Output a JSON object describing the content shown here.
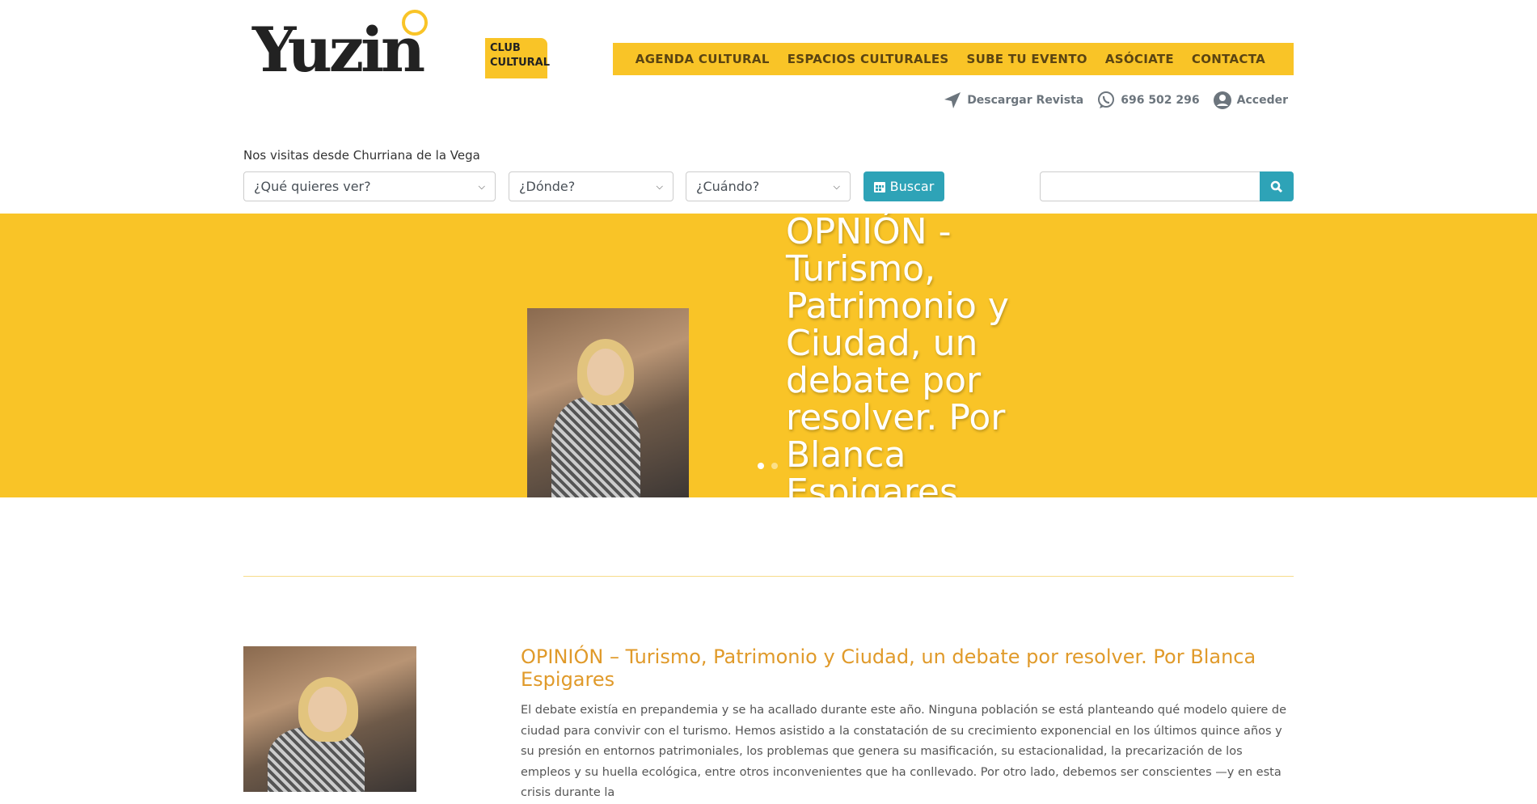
{
  "logo": {
    "word": "Yuzin",
    "tag": "CLUB CULTURAL"
  },
  "nav": [
    "AGENDA CULTURAL",
    "ESPACIOS CULTURALES",
    "SUBE TU EVENTO",
    "ASÓCIATE",
    "CONTACTA"
  ],
  "utility": {
    "magazine": "Descargar Revista",
    "phone": "696 502 296",
    "login": "Acceder"
  },
  "search": {
    "visit_text": "Nos visitas desde Churriana de la Vega",
    "what": "¿Qué quieres ver?",
    "where": "¿Dónde?",
    "when": "¿Cuándo?",
    "button": "Buscar",
    "query": ""
  },
  "colors": {
    "brand": "#f9c427",
    "accent": "#2ea3b7",
    "heading": "#e09a2a"
  },
  "slider": {
    "title": "OPNIÓN - Turismo, Patrimonio y Ciudad, un debate por resolver. Por Blanca Espigares"
  },
  "article": {
    "title": "OPINIÓN – Turismo, Patrimonio y Ciudad, un debate por resolver. Por Blanca Espigares",
    "body": "El debate existía en prepandemia y se ha acallado durante este año. Ninguna población se está planteando qué modelo quiere de ciudad para convivir con el turismo. Hemos asistido a la constatación de su crecimiento exponencial en los últimos quince años y su presión en entornos patrimoniales, los problemas que genera su masificación, su estacionalidad, la precarización de los empleos y su huella ecológica, entre otros inconvenientes que ha conllevado. Por otro lado, debemos ser conscientes —y en esta crisis durante la"
  }
}
